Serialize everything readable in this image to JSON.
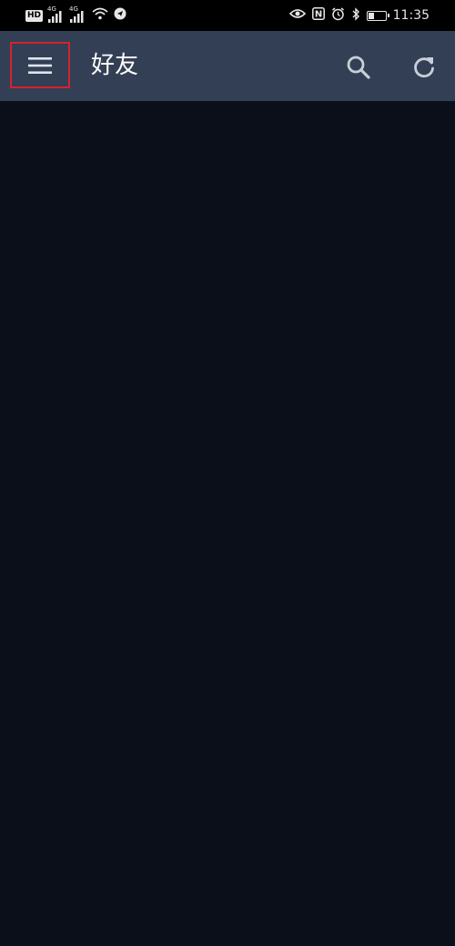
{
  "status_bar": {
    "hd_label": "HD",
    "sim1_network": "4G",
    "sim2_network": "4G",
    "nfc_label": "N",
    "time": "11:35",
    "battery_level": 0.35
  },
  "app_bar": {
    "title": "好友",
    "menu_icon": "hamburger-menu-icon",
    "search_icon": "search-icon",
    "refresh_icon": "refresh-icon",
    "background_color": "#333f54",
    "highlight_color": "#d4232c"
  },
  "content": {
    "background_color": "#0a0f19"
  }
}
